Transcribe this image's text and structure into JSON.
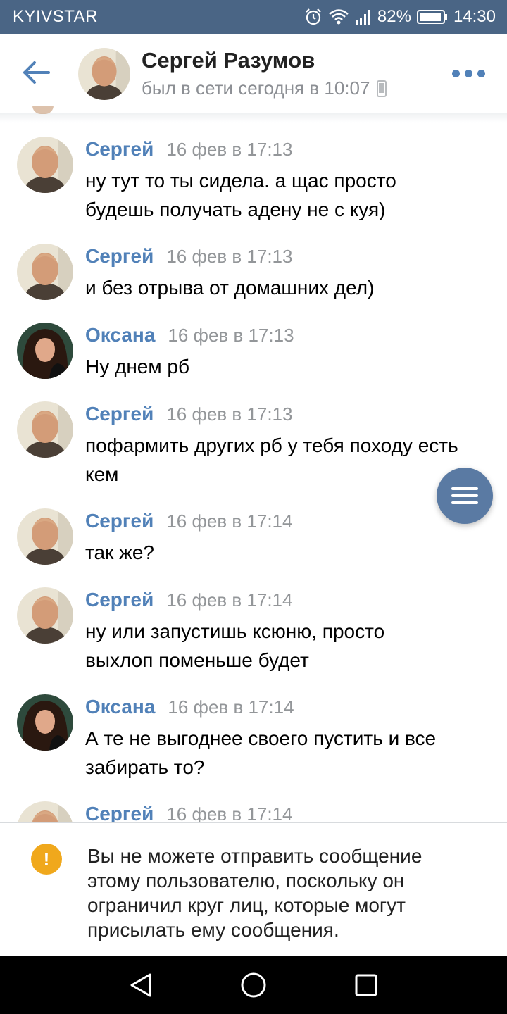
{
  "status_bar": {
    "carrier": "KYIVSTAR",
    "battery": "82%",
    "time": "14:30",
    "icons": [
      "alarm-icon",
      "wifi-icon",
      "signal-icon",
      "battery-icon"
    ]
  },
  "header": {
    "name": "Сергей Разумов",
    "status": "был в сети сегодня в 10:07",
    "icons": [
      "back-arrow-icon",
      "mobile-device-icon",
      "more-dots-icon"
    ]
  },
  "messages": [
    {
      "author": "Сергей",
      "time": "16 фев в 17:13",
      "lines": [
        "ну тут то ты сидела. а щас просто",
        "будешь получать адену не с куя)"
      ]
    },
    {
      "author": "Сергей",
      "time": "16 фев в 17:13",
      "lines": [
        "и без отрыва от домашних дел)"
      ]
    },
    {
      "author": "Оксана",
      "time": "16 фев в 17:13",
      "lines": [
        "Ну днем рб"
      ]
    },
    {
      "author": "Сергей",
      "time": "16 фев в 17:13",
      "lines": [
        "пофармить других рб у тебя походу есть",
        "кем"
      ]
    },
    {
      "author": "Сергей",
      "time": "16 фев в 17:14",
      "lines": [
        "так же?"
      ]
    },
    {
      "author": "Сергей",
      "time": "16 фев в 17:14",
      "lines": [
        "ну или запустишь ксюню, просто",
        "выхлоп поменьше будет"
      ]
    },
    {
      "author": "Оксана",
      "time": "16 фев в 17:14",
      "lines": [
        "А те не выгоднее своего пустить и все",
        "забирать то?"
      ]
    },
    {
      "author": "Сергей",
      "time": "16 фев в 17:14",
      "lines": []
    }
  ],
  "notice": {
    "icon_text": "!",
    "lines": [
      "Вы не можете отправить сообщение",
      "этому пользователю, поскольку он",
      "ограничил круг лиц, которые могут",
      "присылать ему сообщения."
    ]
  },
  "colors": {
    "status_bar": "#4a6585",
    "accent": "#5181b8",
    "fab": "#5a7aa3",
    "warning": "#f0a81c"
  },
  "nav_bar": {
    "icons": [
      "back-triangle-icon",
      "home-circle-icon",
      "recents-square-icon"
    ]
  }
}
